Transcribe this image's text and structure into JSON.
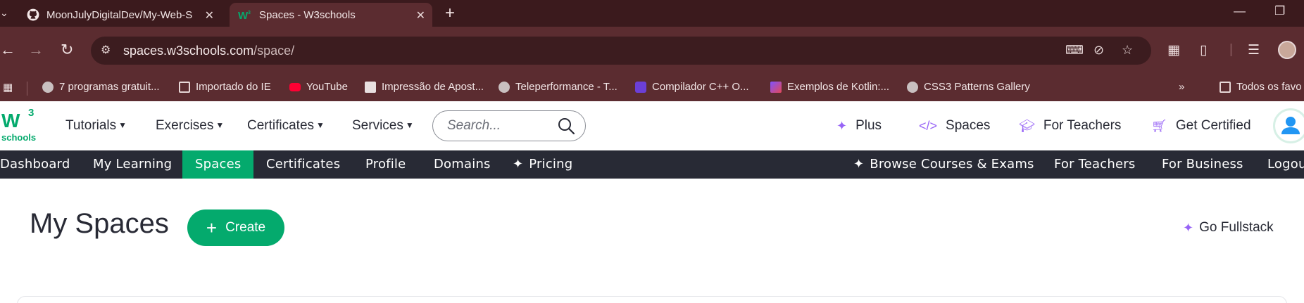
{
  "browser": {
    "tabs": [
      {
        "title": "MoonJulyDigitalDev/My-Web-S",
        "icon": "github-icon"
      },
      {
        "title": "Spaces - W3schools",
        "icon": "w3schools-icon"
      }
    ],
    "address": {
      "host": "spaces.w3schools.com",
      "path": "/space/"
    },
    "bookmarks": [
      {
        "label": "7 programas gratuit...",
        "icon": "globe-icon"
      },
      {
        "label": "Importado do IE",
        "icon": "folder-icon"
      },
      {
        "label": "YouTube",
        "icon": "youtube-icon"
      },
      {
        "label": "Impressão de Apost...",
        "icon": "printer-icon"
      },
      {
        "label": "Teleperformance - T...",
        "icon": "globe-icon"
      },
      {
        "label": "Compilador C++ O...",
        "icon": "bolt-icon"
      },
      {
        "label": "Exemplos de Kotlin:...",
        "icon": "kotlin-icon"
      },
      {
        "label": "CSS3 Patterns Gallery",
        "icon": "globe-icon"
      },
      {
        "label": "Todos os favo",
        "icon": "folder-icon"
      }
    ]
  },
  "w3": {
    "logo": {
      "w": "W",
      "sup": "3",
      "sub": "schools"
    },
    "menu": [
      {
        "label": "Tutorials"
      },
      {
        "label": "Exercises"
      },
      {
        "label": "Certificates"
      },
      {
        "label": "Services"
      }
    ],
    "search": {
      "placeholder": "Search..."
    },
    "right_links": [
      {
        "label": "Plus",
        "icon": "sparkle-icon"
      },
      {
        "label": "Spaces",
        "icon": "code-icon"
      },
      {
        "label": "For Teachers",
        "icon": "graduation-cap-icon"
      },
      {
        "label": "Get Certified",
        "icon": "cart-icon"
      }
    ],
    "subnav": [
      {
        "label": "Dashboard"
      },
      {
        "label": "My Learning"
      },
      {
        "label": "Spaces",
        "active": true
      },
      {
        "label": "Certificates"
      },
      {
        "label": "Profile"
      },
      {
        "label": "Domains"
      },
      {
        "label": "Pricing"
      }
    ],
    "subnav_right": [
      {
        "label": "Browse Courses & Exams"
      },
      {
        "label": "For Teachers"
      },
      {
        "label": "For Business"
      },
      {
        "label": "Logou"
      }
    ]
  },
  "content": {
    "title": "My Spaces",
    "create_label": "Create",
    "fullstack_label": "Go Fullstack"
  },
  "colors": {
    "w3_green": "#04aa6d",
    "w3_dark": "#282a35",
    "accent_purple": "#9763f6",
    "chrome_dark": "#3b1a1d",
    "chrome_toolbar": "#5b2c30"
  }
}
